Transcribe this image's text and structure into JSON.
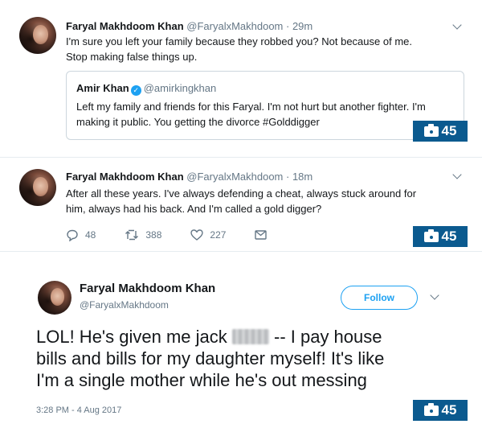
{
  "tweet1": {
    "name": "Faryal Makhdoom Khan",
    "handle": "@FaryalxMakhdoom",
    "time": " · 29m",
    "text_line1": "I'm sure you left your family because they robbed you? Not because of me.",
    "text_line2": "Stop making false things up.",
    "quote": {
      "name": "Amir Khan",
      "handle": "@amirkingkhan",
      "text_line1": "Left my family and friends for this Faryal. I'm not hurt but another fighter. I'm",
      "text_line2": "making it public. You getting the divorce #Golddigger"
    },
    "badge": "45"
  },
  "tweet2": {
    "name": "Faryal Makhdoom Khan",
    "handle": "@FaryalxMakhdoom",
    "time": " · 18m",
    "text_line1": "After all these years. I've always defending a cheat, always stuck around for",
    "text_line2": "him, always had his back. And I'm called a gold digger?",
    "replies": "48",
    "retweets": "388",
    "likes": "227",
    "badge": "45"
  },
  "tweet3": {
    "name": "Faryal Makhdoom Khan",
    "handle": "@FaryalxMakhdoom",
    "follow_label": "Follow",
    "text_pre": "LOL! He's given me jack",
    "text_post": " -- I pay house",
    "text_line2": "bills and bills for my daughter myself! It's like",
    "text_line3": "I'm a single mother while he's out messing",
    "date": "3:28 PM - 4 Aug 2017",
    "badge": "45"
  },
  "colors": {
    "link_blue": "#1da1f2",
    "badge_blue": "#0b5a8f",
    "muted_gray": "#657786"
  },
  "icons": [
    "chevron-down-icon",
    "verified-icon",
    "reply-icon",
    "retweet-icon",
    "like-icon",
    "message-icon",
    "camera-icon"
  ]
}
